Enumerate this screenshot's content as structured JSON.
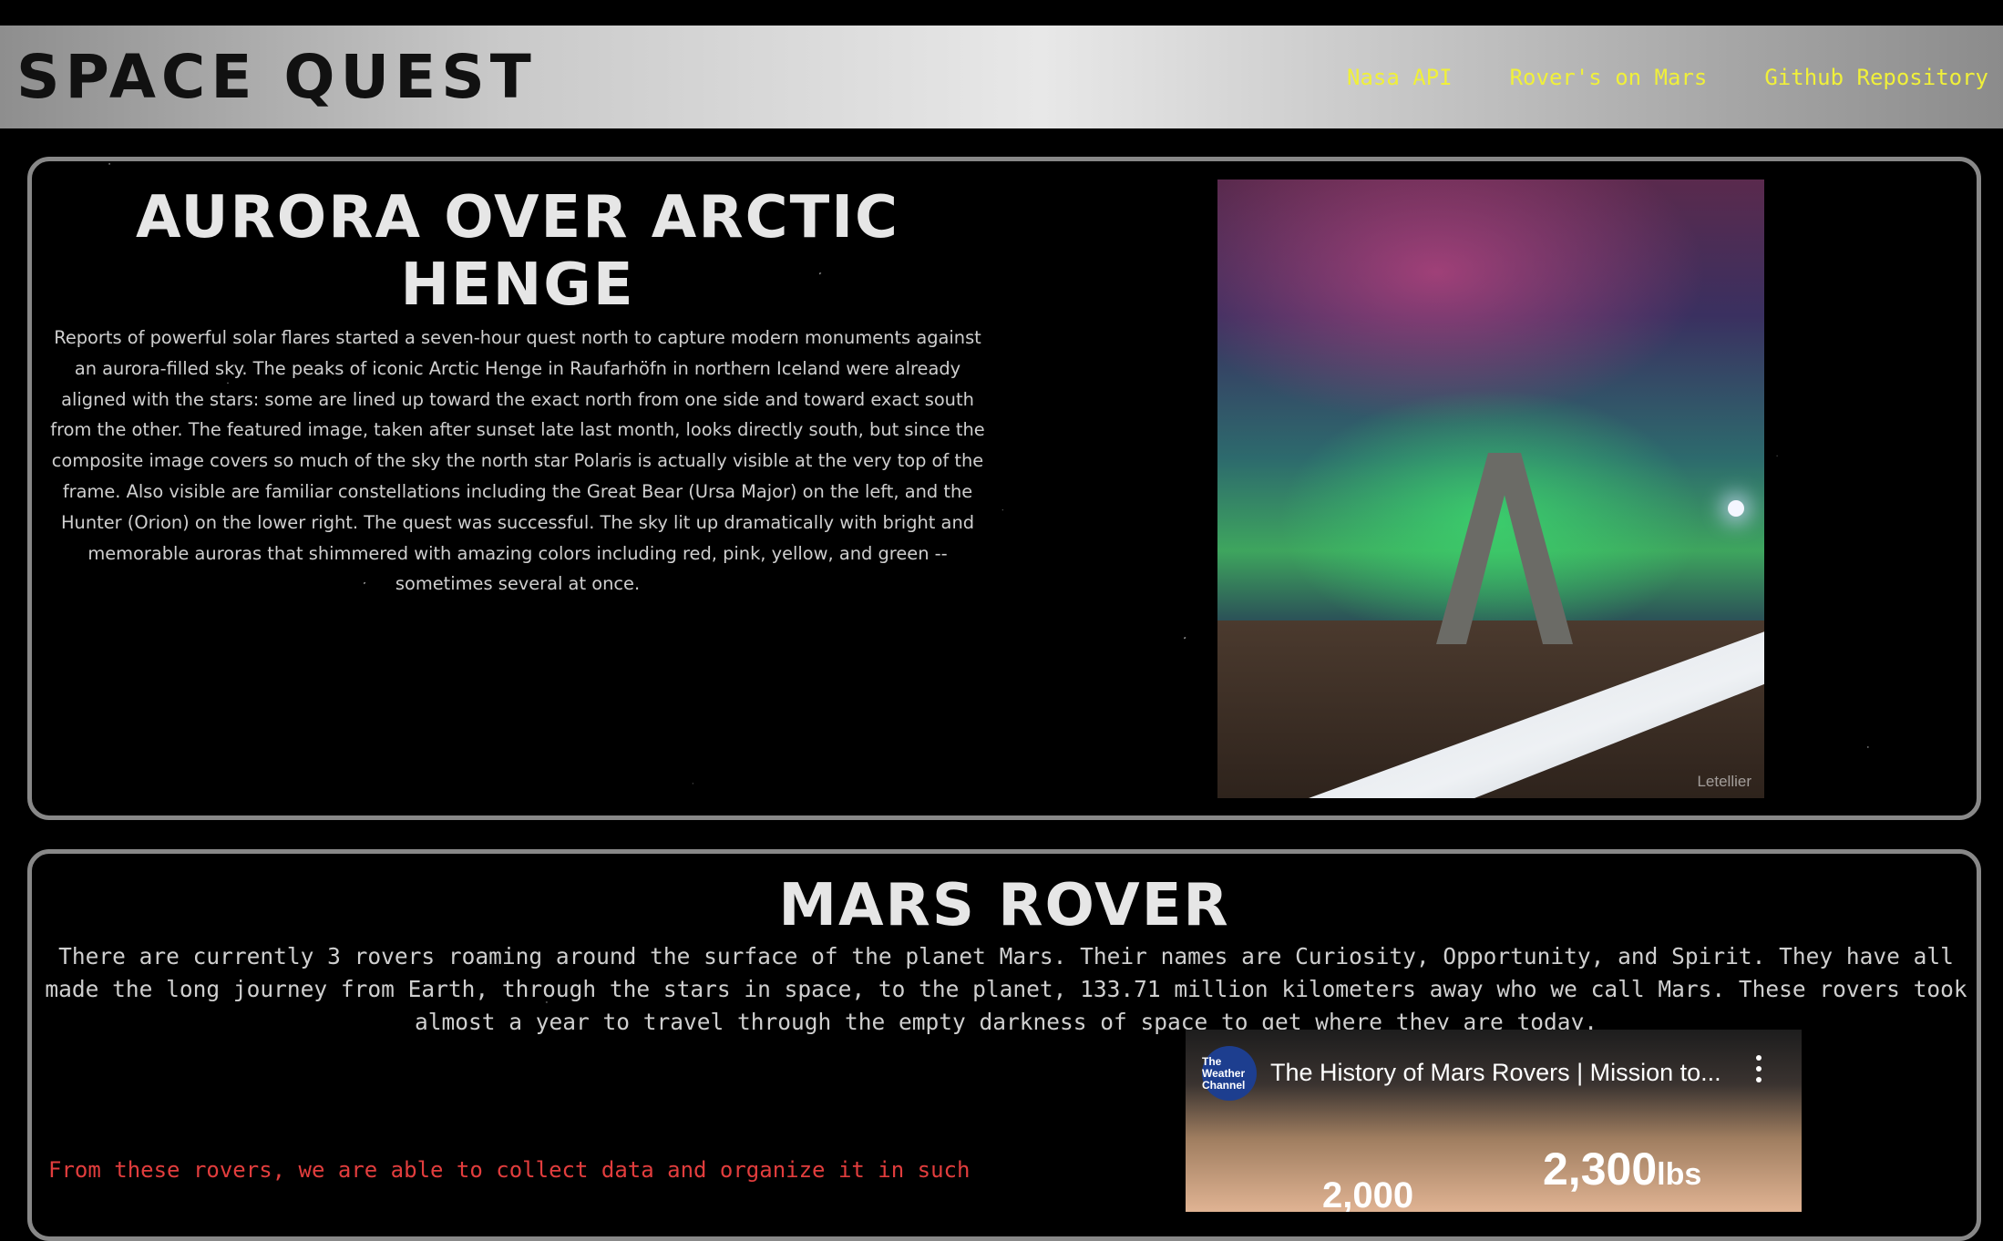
{
  "navbar": {
    "brand": "SPACE QUEST",
    "links": [
      "Nasa API",
      "Rover's on Mars",
      "Github Repository"
    ],
    "link_color": "#f0f03a"
  },
  "apod": {
    "title": "AURORA OVER ARCTIC HENGE",
    "explanation": "Reports of powerful solar flares started a seven-hour quest north to capture modern monuments against an aurora-filled sky. The peaks of iconic Arctic Henge in Raufarhöfn in northern Iceland were already aligned with the stars: some are lined up toward the exact north from one side and toward exact south from the other. The featured image, taken after sunset late last month, looks directly south, but since the composite image covers so much of the sky the north star Polaris is actually visible at the very top of the frame. Also visible are familiar constellations including the Great Bear (Ursa Major) on the left, and the Hunter (Orion) on the lower right. The quest was successful. The sky lit up dramatically with bright and memorable auroras that shimmered with amazing colors including red, pink, yellow, and green -- sometimes several at once.",
    "image_credit": "Letellier"
  },
  "mars": {
    "title": "MARS ROVER",
    "description": "There are currently 3 rovers roaming around the surface of the planet Mars. Their names are Curiosity, Opportunity, and Spirit. They have all made the long journey from Earth, through the stars in space, to the planet, 133.71 million kilometers away who we call Mars. These rovers took almost a year to travel through the empty darkness of space to get where they are today.",
    "red_text": "From these rovers, we are able to collect data and organize it in such",
    "red_color": "#e23d3d"
  },
  "video": {
    "channel": "The Weather Channel",
    "title": "The History of Mars Rovers | Mission to...",
    "stat": "2,300",
    "stat_unit": "lbs",
    "stat2": "2,000"
  }
}
